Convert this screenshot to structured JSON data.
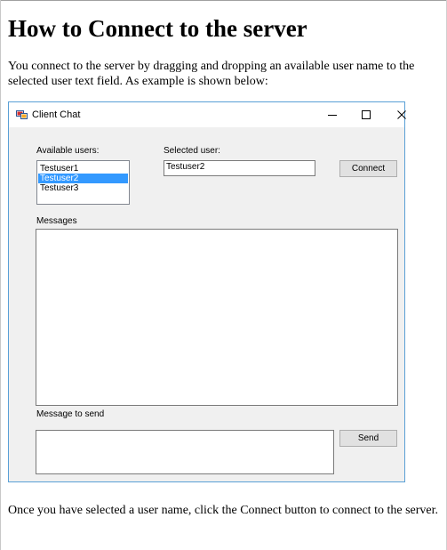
{
  "article": {
    "title": "How to Connect to the server",
    "intro": "You connect to the server by dragging and dropping an available user name to the selected user text field. As example is shown below:",
    "outro": "Once you have selected a user name, click the Connect button to connect to the server."
  },
  "window": {
    "title": "Client Chat",
    "available_users_label": "Available users:",
    "available_users": [
      "Testuser1",
      "Testuser2",
      "Testuser3"
    ],
    "selected_user_label": "Selected user:",
    "selected_user_value": "Testuser2",
    "connect_label": "Connect",
    "messages_label": "Messages",
    "message_to_send_label": "Message to send",
    "send_label": "Send"
  },
  "colors": {
    "selection": "#3399ff",
    "window_border": "#5aa0d6",
    "form_background": "#f0f0f0"
  }
}
